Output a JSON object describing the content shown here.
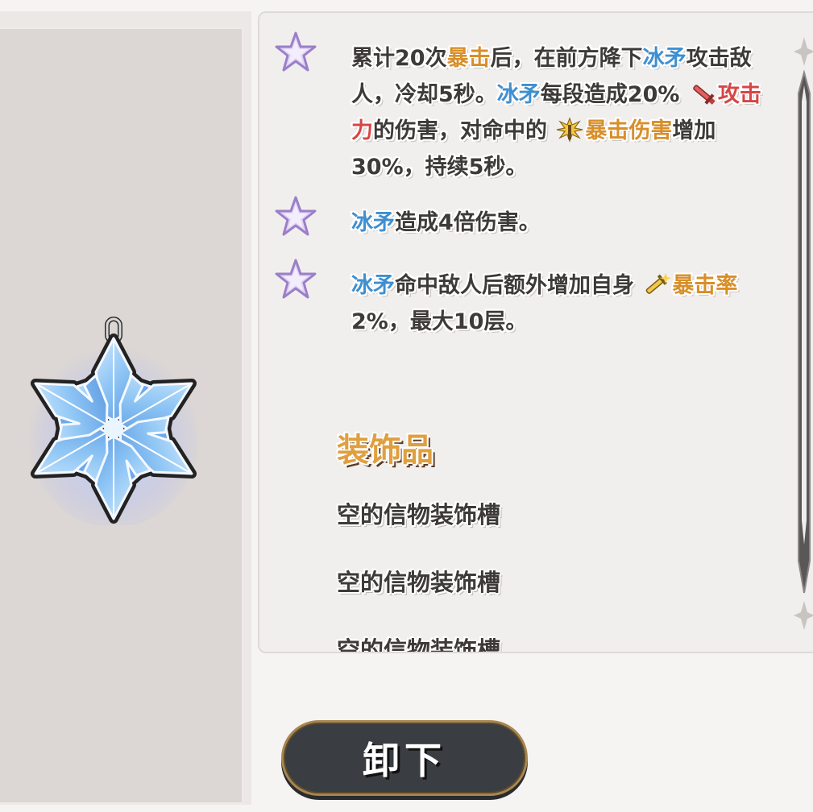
{
  "relic": {
    "icon": "ice-snowflake-relic-icon"
  },
  "effects": [
    {
      "segments": [
        {
          "text": "累计20次",
          "style": "normal"
        },
        {
          "text": "暴击",
          "style": "crit"
        },
        {
          "text": "后，在前方降下",
          "style": "normal"
        },
        {
          "text": "冰矛",
          "style": "ice"
        },
        {
          "text": "攻击敌人，冷却5秒。",
          "style": "normal"
        },
        {
          "text": "冰矛",
          "style": "ice"
        },
        {
          "text": "每段造成20% ",
          "style": "normal"
        },
        {
          "text": "sword-icon",
          "style": "icon"
        },
        {
          "text": "攻击力",
          "style": "atk"
        },
        {
          "text": "的伤害，对命中的 ",
          "style": "normal"
        },
        {
          "text": "crit-damage-icon",
          "style": "icon"
        },
        {
          "text": "暴击伤害",
          "style": "crit"
        },
        {
          "text": "增加30%，持续5秒。",
          "style": "normal"
        }
      ]
    },
    {
      "segments": [
        {
          "text": "冰矛",
          "style": "ice"
        },
        {
          "text": "造成4倍伤害。",
          "style": "normal"
        }
      ]
    },
    {
      "segments": [
        {
          "text": "冰矛",
          "style": "ice"
        },
        {
          "text": "命中敌人后额外增加自身 ",
          "style": "normal"
        },
        {
          "text": "crit-rate-icon",
          "style": "icon"
        },
        {
          "text": "暴击率",
          "style": "crit"
        },
        {
          "text": "2%，最大10层。",
          "style": "normal"
        }
      ]
    }
  ],
  "accessories": {
    "title": "装饰品",
    "slots": [
      "空的信物装饰槽",
      "空的信物装饰槽",
      "空的信物装饰槽"
    ]
  },
  "actions": {
    "unequip_label": "卸下"
  },
  "colors": {
    "ice": "#3f8fd0",
    "crit": "#d88f2a",
    "attack": "#d84545",
    "button_bg": "#3a3d42",
    "button_border": "#a8864f"
  }
}
